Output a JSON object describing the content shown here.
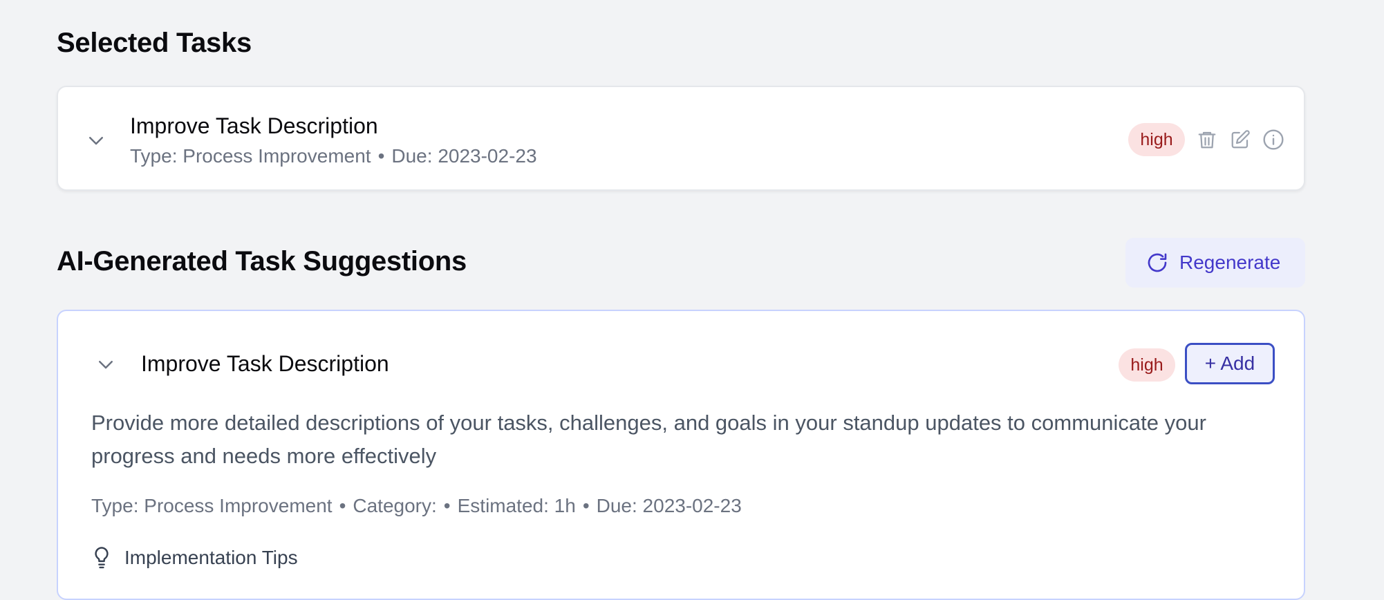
{
  "selected_section": {
    "title": "Selected Tasks",
    "task": {
      "title": "Improve Task Description",
      "type_text": "Type: Process Improvement",
      "separator": "•",
      "due_text": "Due: 2023-02-23",
      "priority": "high",
      "icons": [
        "chevron-down-icon",
        "trash-icon",
        "edit-icon",
        "info-icon"
      ]
    }
  },
  "suggestions_section": {
    "title": "AI-Generated Task Suggestions",
    "regenerate_label": "Regenerate",
    "suggestion": {
      "title": "Improve Task Description",
      "priority": "high",
      "add_label": "+ Add",
      "description": "Provide more detailed descriptions of your tasks, challenges, and goals in your standup updates to communicate your progress and needs more effectively",
      "type_text": "Type: Process Improvement",
      "category_text": "Category:",
      "estimated_text": "Estimated: 1h",
      "due_text": "Due: 2023-02-23",
      "separator": "•",
      "tips_label": "Implementation Tips"
    }
  },
  "colors": {
    "background": "#f2f3f5",
    "accent": "#4338ca",
    "priority_high_bg": "#fbe2e2",
    "priority_high_text": "#991b1b",
    "suggestion_border": "#c7d2fe"
  }
}
